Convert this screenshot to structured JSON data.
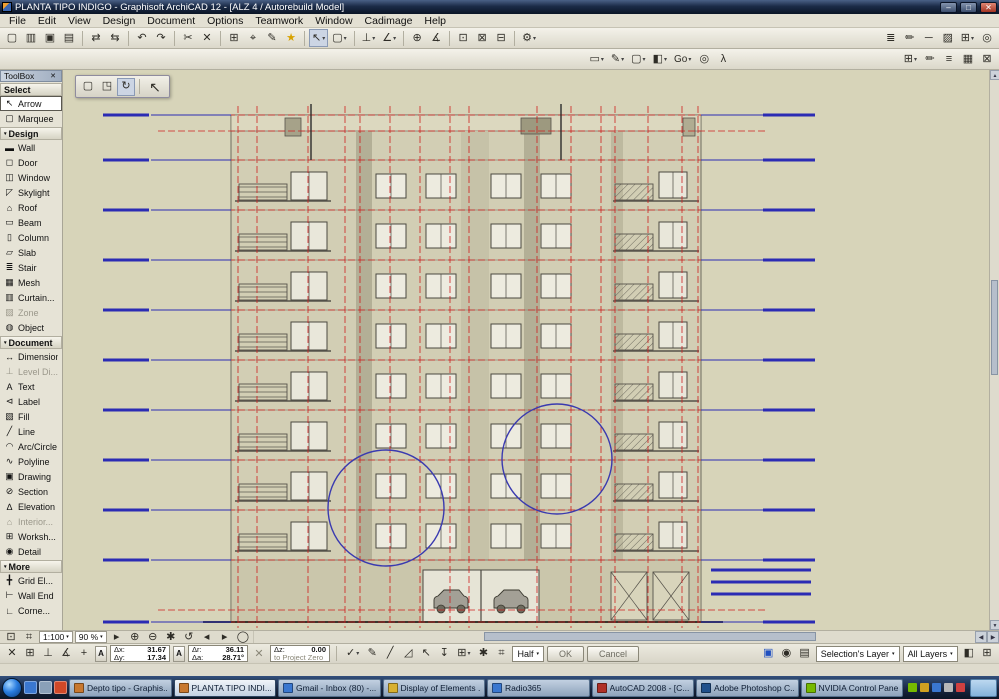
{
  "ui": {
    "dropdown_glyph": "▾",
    "up_glyph": "▲",
    "down_glyph": "▼",
    "left_glyph": "◀",
    "right_glyph": "▶",
    "close_glyph": "✕",
    "min_glyph": "–",
    "max_glyph": "□",
    "a_glyph": "A"
  },
  "titlebar": {
    "title": "PLANTA TIPO INDIGO - Graphisoft ArchiCAD 12 - [ALZ 4 / Autorebuild Model]"
  },
  "menu": {
    "items": [
      "File",
      "Edit",
      "View",
      "Design",
      "Document",
      "Options",
      "Teamwork",
      "Window",
      "Cadimage",
      "Help"
    ]
  },
  "toolbar_main": {
    "items": [
      {
        "name": "new-button",
        "glyph": "▢"
      },
      {
        "name": "open-button",
        "glyph": "▥"
      },
      {
        "name": "save-button",
        "glyph": "▣"
      },
      {
        "name": "print-button",
        "glyph": "▤"
      },
      {
        "type": "sep"
      },
      {
        "name": "send-changes-button",
        "glyph": "⇄"
      },
      {
        "name": "receive-changes-button",
        "glyph": "⇆"
      },
      {
        "type": "sep"
      },
      {
        "name": "undo-button",
        "glyph": "↶"
      },
      {
        "name": "redo-button",
        "glyph": "↷"
      },
      {
        "type": "sep"
      },
      {
        "name": "cut-button",
        "glyph": "✂"
      },
      {
        "name": "delete-button",
        "glyph": "✕"
      },
      {
        "type": "sep"
      },
      {
        "name": "snap-grid-button",
        "glyph": "⊞"
      },
      {
        "name": "snap-points-button",
        "glyph": "⌖"
      },
      {
        "name": "pen-button",
        "glyph": "✎"
      },
      {
        "name": "favorites-button",
        "glyph": "★",
        "color": "#d8a200"
      },
      {
        "type": "sep"
      },
      {
        "name": "arrow-tool-combo",
        "glyph": "↖",
        "dd": true,
        "state": "pressed"
      },
      {
        "name": "marquee-tool-combo",
        "glyph": "▢",
        "dd": true
      },
      {
        "type": "sep"
      },
      {
        "name": "guideline-combo",
        "glyph": "⊥",
        "dd": true
      },
      {
        "name": "slope-combo",
        "glyph": "∠",
        "dd": true
      },
      {
        "type": "sep"
      },
      {
        "name": "origin-button",
        "glyph": "⊕"
      },
      {
        "name": "measure-button",
        "glyph": "∡"
      },
      {
        "type": "sep"
      },
      {
        "name": "group-button",
        "glyph": "⊡"
      },
      {
        "name": "lock-button",
        "glyph": "⊠"
      },
      {
        "name": "bring-forward-button",
        "glyph": "⊟"
      },
      {
        "type": "sep"
      },
      {
        "name": "settings-combo",
        "glyph": "⚙",
        "dd": true
      },
      {
        "type": "spacer"
      },
      {
        "name": "layers-button",
        "glyph": "≣"
      },
      {
        "name": "pen-sets-button",
        "glyph": "✏"
      },
      {
        "name": "line-weight-button",
        "glyph": "─"
      },
      {
        "name": "materials-button",
        "glyph": "▨"
      },
      {
        "name": "grid-display-combo",
        "glyph": "⊞",
        "dd": true
      },
      {
        "name": "camera-button",
        "glyph": "◎"
      }
    ]
  },
  "toolbar_second": {
    "items": [
      {
        "type": "spacer",
        "grow": 7
      },
      {
        "name": "virtual-trace-combo",
        "glyph": "▭",
        "dd": true
      },
      {
        "name": "trace-reference-combo",
        "glyph": "✎",
        "dd": true
      },
      {
        "name": "drawing-combo",
        "glyph": "▢",
        "dd": true
      },
      {
        "name": "view-combo",
        "glyph": "◧",
        "dd": true
      },
      {
        "name": "go-combo",
        "label": "Go",
        "dd": true
      },
      {
        "name": "orbit-button",
        "glyph": "◎"
      },
      {
        "name": "explore-button",
        "glyph": "λ"
      },
      {
        "type": "spacer",
        "grow": 2
      },
      {
        "name": "display-order-combo",
        "glyph": "⊞",
        "dd": true
      },
      {
        "name": "annotate-button",
        "glyph": "✏"
      },
      {
        "name": "list-button",
        "glyph": "≡"
      },
      {
        "name": "hatch-button",
        "glyph": "▦"
      },
      {
        "name": "close-panel-button",
        "glyph": "⊠"
      }
    ]
  },
  "mini_toolbar": {
    "items": [
      {
        "name": "marquee-mode-button",
        "glyph": "▢"
      },
      {
        "name": "selection-mode-button",
        "glyph": "◳"
      },
      {
        "name": "rotate-mode-button",
        "glyph": "↻",
        "state": "pressed"
      },
      {
        "type": "sep"
      },
      {
        "name": "arrow-cursor-button",
        "glyph": "↖",
        "big": true
      }
    ]
  },
  "toolbox": {
    "title": "ToolBox",
    "sections": [
      {
        "label": "Select",
        "items": [
          {
            "icon": "↖",
            "label": "Arrow",
            "state": "selected"
          },
          {
            "icon": "▢",
            "label": "Marquee"
          }
        ]
      },
      {
        "label": "Design",
        "arrow": true,
        "items": [
          {
            "icon": "▬",
            "label": "Wall"
          },
          {
            "icon": "◻",
            "label": "Door"
          },
          {
            "icon": "◫",
            "label": "Window"
          },
          {
            "icon": "◸",
            "label": "Skylight"
          },
          {
            "icon": "⌂",
            "label": "Roof"
          },
          {
            "icon": "▭",
            "label": "Beam"
          },
          {
            "icon": "▯",
            "label": "Column"
          },
          {
            "icon": "▱",
            "label": "Slab"
          },
          {
            "icon": "≣",
            "label": "Stair"
          },
          {
            "icon": "▦",
            "label": "Mesh"
          },
          {
            "icon": "▥",
            "label": "Curtain..."
          },
          {
            "icon": "▨",
            "label": "Zone",
            "state": "disabled"
          },
          {
            "icon": "◍",
            "label": "Object"
          }
        ]
      },
      {
        "label": "Document",
        "arrow": true,
        "items": [
          {
            "icon": "↔",
            "label": "Dimension"
          },
          {
            "icon": "⊥",
            "label": "Level Di...",
            "state": "disabled"
          },
          {
            "icon": "A",
            "label": "Text"
          },
          {
            "icon": "⊲",
            "label": "Label"
          },
          {
            "icon": "▧",
            "label": "Fill"
          },
          {
            "icon": "╱",
            "label": "Line"
          },
          {
            "icon": "◠",
            "label": "Arc/Circle"
          },
          {
            "icon": "∿",
            "label": "Polyline"
          },
          {
            "icon": "▣",
            "label": "Drawing"
          },
          {
            "icon": "⊘",
            "label": "Section"
          },
          {
            "icon": "∆",
            "label": "Elevation"
          },
          {
            "icon": "⌂",
            "label": "Interior...",
            "state": "disabled"
          },
          {
            "icon": "⊞",
            "label": "Worksh..."
          },
          {
            "icon": "◉",
            "label": "Detail"
          }
        ]
      },
      {
        "label": "More",
        "arrow": true,
        "items": [
          {
            "icon": "╋",
            "label": "Grid El..."
          },
          {
            "icon": "⊢",
            "label": "Wall End"
          },
          {
            "icon": "∟",
            "label": "Corne..."
          }
        ]
      }
    ]
  },
  "quickbar": {
    "scale": "1:100",
    "zoom": "90 %",
    "left_icons": [
      {
        "name": "pan-mode-button",
        "glyph": "⊡"
      },
      {
        "name": "grid-mode-button",
        "glyph": "⌗"
      }
    ],
    "zoom_icons": [
      {
        "name": "fit-view-button",
        "glyph": "▸"
      },
      {
        "name": "zoom-in-button",
        "glyph": "⊕"
      },
      {
        "name": "zoom-out-button",
        "glyph": "⊖"
      },
      {
        "name": "pan-button",
        "glyph": "✱"
      },
      {
        "name": "rotate-view-button",
        "glyph": "↺"
      },
      {
        "name": "previous-view-button",
        "glyph": "◂"
      },
      {
        "name": "next-view-button",
        "glyph": "▸"
      },
      {
        "name": "fit-window-button",
        "glyph": "◯"
      }
    ]
  },
  "tracker": {
    "dx_label": "Δx:",
    "dx": "31.67",
    "dy_label": "Δy:",
    "dy": "17.34",
    "dr_label": "Δr:",
    "dr": "36.11",
    "da_label": "Δa:",
    "da": "28.71°",
    "dz_label": "Δz:",
    "dz": "0.00",
    "ref": "to Project Zero"
  },
  "tracker_bar": {
    "left_icons": [
      {
        "name": "tracker-close-button",
        "glyph": "✕"
      },
      {
        "name": "grid-snap-toggle",
        "glyph": "⊞"
      },
      {
        "name": "gravity-toggle",
        "glyph": "⊥"
      },
      {
        "name": "angle-snap-toggle",
        "glyph": "∡"
      },
      {
        "name": "add-point-button",
        "glyph": "+"
      }
    ],
    "mid_icons": [
      {
        "name": "relative-coords-combo",
        "glyph": "✓",
        "dd": true
      },
      {
        "name": "pen-weight-button",
        "glyph": "✎"
      },
      {
        "name": "line-style-button",
        "glyph": "╱"
      },
      {
        "name": "angle-tool-button",
        "glyph": "◿"
      },
      {
        "name": "cursor-snap-button",
        "glyph": "↖"
      },
      {
        "name": "project-down-button",
        "glyph": "↧"
      },
      {
        "name": "construction-grid-combo",
        "glyph": "⊞",
        "dd": true
      },
      {
        "name": "move-button",
        "glyph": "✱"
      },
      {
        "name": "coordinate-grid-button",
        "glyph": "⌗"
      }
    ]
  },
  "controls": {
    "half": "Half",
    "ok": "OK",
    "cancel": "Cancel"
  },
  "layer_bar": {
    "icons": [
      {
        "name": "quick-layers-button",
        "glyph": "▣",
        "color": "#2050c0"
      },
      {
        "name": "layer-visibility-button",
        "glyph": "◉"
      },
      {
        "name": "layer-list-button",
        "glyph": "▤"
      }
    ],
    "selection": "Selection's Layer",
    "all": "All Layers",
    "end_icons": [
      {
        "name": "panel-toggle-button",
        "glyph": "◧"
      },
      {
        "name": "grid-toggle-button",
        "glyph": "⊞"
      }
    ]
  },
  "taskbar": {
    "quick_launch": [
      {
        "name": "quick-launch-browser",
        "color": "#3a77d0"
      },
      {
        "name": "quick-launch-desktop",
        "color": "#8aa0b8"
      },
      {
        "name": "quick-launch-media",
        "color": "#d04828"
      }
    ],
    "items": [
      {
        "label": "Depto tipo - Graphis...",
        "color": "#c87830"
      },
      {
        "label": "PLANTA TIPO INDI...",
        "color": "#c87830",
        "state": "active"
      },
      {
        "label": "Gmail - Inbox (80) -...",
        "color": "#3a77d0"
      },
      {
        "label": "Display of Elements ...",
        "color": "#d8b030"
      },
      {
        "label": "Radio365",
        "color": "#3a77d0"
      },
      {
        "label": "AutoCAD 2008 - [C...",
        "color": "#b03028"
      },
      {
        "label": "Adobe Photoshop C...",
        "color": "#20508c"
      },
      {
        "label": "NVIDIA Control Panel",
        "color": "#76b900"
      }
    ],
    "tray": [
      {
        "name": "tray-icon-nvidia",
        "color": "#76b900"
      },
      {
        "name": "tray-icon-update",
        "color": "#d0a020"
      },
      {
        "name": "tray-icon-network",
        "color": "#3a77d0"
      },
      {
        "name": "tray-icon-volume",
        "color": "#b8b8b8"
      },
      {
        "name": "tray-icon-security",
        "color": "#d04040"
      }
    ]
  }
}
